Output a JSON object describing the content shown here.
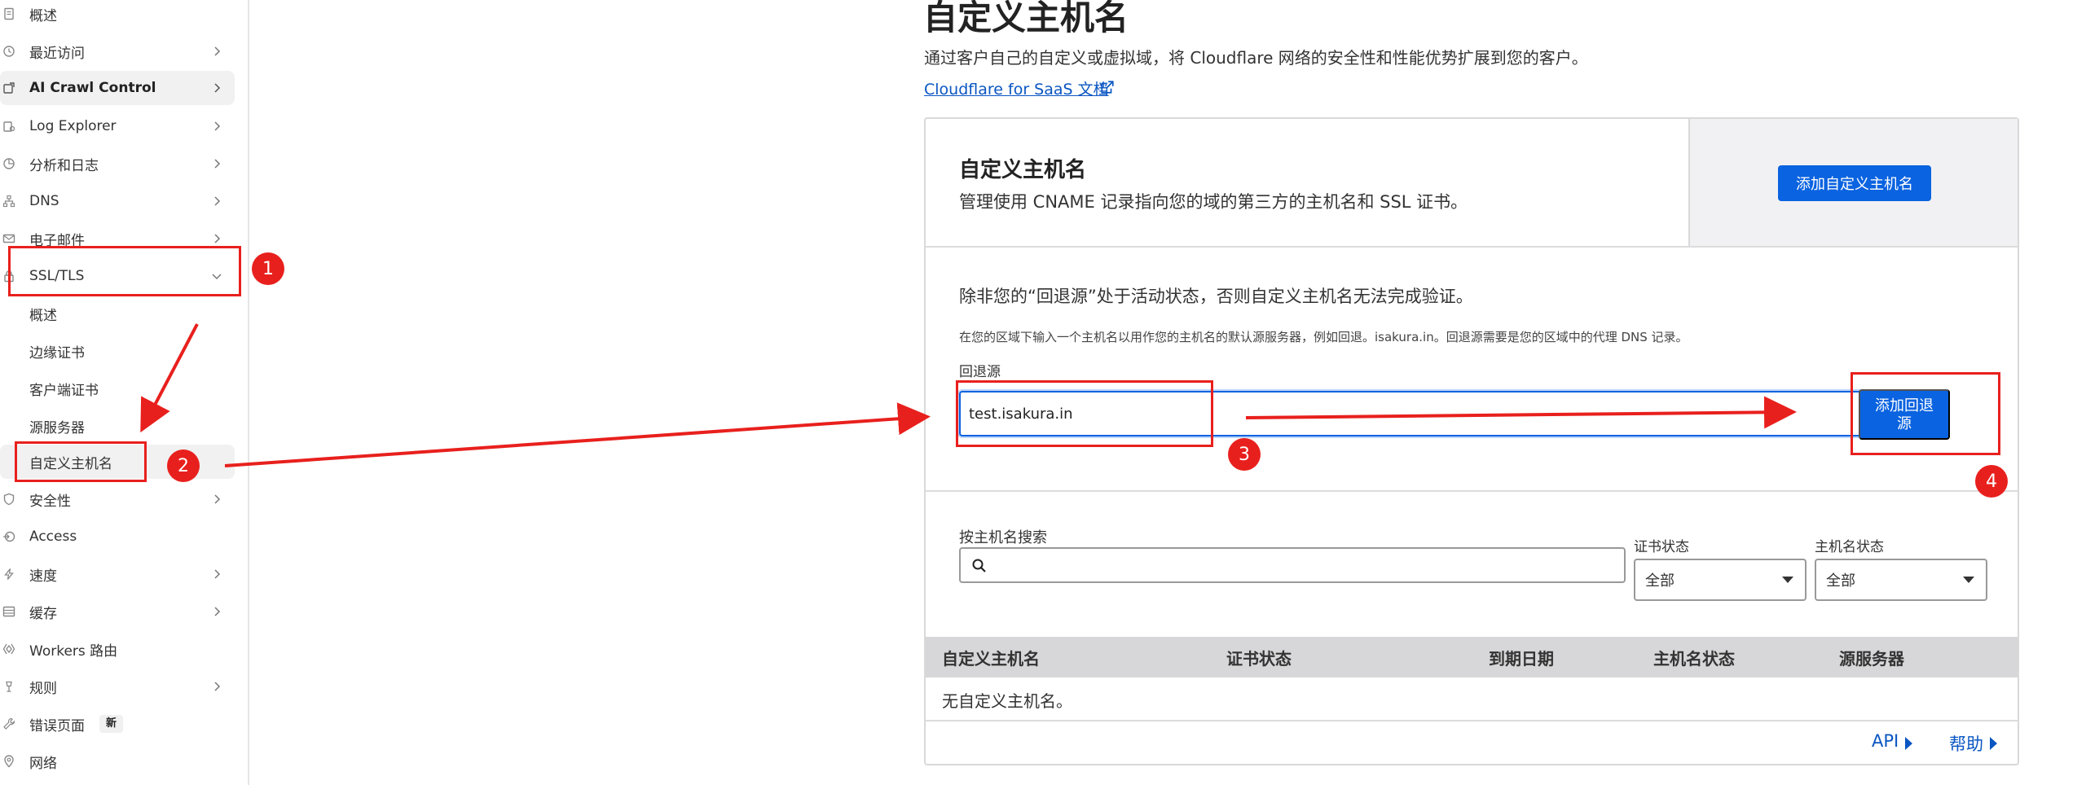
{
  "sidebar": {
    "items": [
      {
        "label": "概述",
        "icon": "document-icon",
        "chevron": false
      },
      {
        "label": "最近访问",
        "icon": "clock-icon",
        "chevron": true
      },
      {
        "label": "AI Crawl Control",
        "icon": "ai-crawl-icon",
        "chevron": true
      },
      {
        "label": "Log Explorer",
        "icon": "log-icon",
        "chevron": true
      },
      {
        "label": "分析和日志",
        "icon": "chart-icon",
        "chevron": true
      },
      {
        "label": "DNS",
        "icon": "network-icon",
        "chevron": true
      },
      {
        "label": "电子邮件",
        "icon": "email-icon",
        "chevron": true
      },
      {
        "label": "SSL/TLS",
        "icon": "lock-icon",
        "chevron": true
      },
      {
        "label": "安全性",
        "icon": "shield-icon",
        "chevron": true
      },
      {
        "label": "Access",
        "icon": "access-icon",
        "chevron": false
      },
      {
        "label": "速度",
        "icon": "lightning-icon",
        "chevron": true
      },
      {
        "label": "缓存",
        "icon": "cache-icon",
        "chevron": true
      },
      {
        "label": "Workers 路由",
        "icon": "workers-icon",
        "chevron": false
      },
      {
        "label": "规则",
        "icon": "rules-icon",
        "chevron": true
      },
      {
        "label": "错误页面",
        "icon": "wrench-icon",
        "chevron": false,
        "badge": "新"
      },
      {
        "label": "网络",
        "icon": "location-icon",
        "chevron": false
      }
    ],
    "ssl_sub_items": [
      "概述",
      "边缘证书",
      "客户端证书",
      "源服务器",
      "自定义主机名"
    ]
  },
  "main": {
    "title": "自定义主机名",
    "description": "通过客户自己的自定义或虚拟域，将 Cloudflare 网络的安全性和性能优势扩展到您的客户。",
    "doc_link": "Cloudflare for SaaS 文档",
    "section": {
      "title": "自定义主机名",
      "description": "管理使用 CNAME 记录指向您的域的第三方的主机名和 SSL 证书。",
      "add_button": "添加自定义主机名"
    },
    "fallback": {
      "warning": "除非您的“回退源”处于活动状态，否则自定义主机名无法完成验证。",
      "description": "在您的区域下输入一个主机名以用作您的主机名的默认源服务器，例如回退。isakura.in。回退源需要是您的区域中的代理 DNS 记录。",
      "label": "回退源",
      "value": "test.isakura.in",
      "button": "添加回退源"
    },
    "filters": {
      "search_label": "按主机名搜索",
      "search_value": "",
      "cert_status_label": "证书状态",
      "cert_status_value": "全部",
      "host_status_label": "主机名状态",
      "host_status_value": "全部"
    },
    "table": {
      "columns": [
        "自定义主机名",
        "证书状态",
        "到期日期",
        "主机名状态",
        "源服务器"
      ],
      "empty": "无自定义主机名。"
    },
    "footer": {
      "api": "API",
      "help": "帮助"
    }
  },
  "annotations": {
    "markers": [
      "1",
      "2",
      "3",
      "4"
    ],
    "color": "#e8201d"
  },
  "colors": {
    "accent": "#0a63e0",
    "link": "#0a56c2",
    "table_header": "#d7d7d9"
  }
}
